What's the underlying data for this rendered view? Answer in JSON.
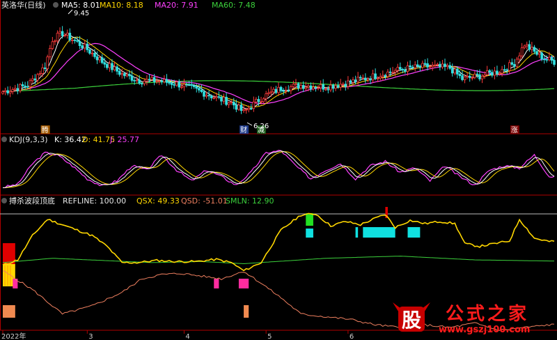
{
  "stock": {
    "name": "英洛华(日线)",
    "ma_labels": [
      "MA5: 8.01",
      "MA10: 8.18",
      "MA20: 7.91",
      "MA60: 7.48"
    ],
    "ma_colors": [
      "#ffffff",
      "#ffd700",
      "#ff40ff",
      "#3cd23c"
    ],
    "high_label": "9.45",
    "low_label": "6.26",
    "markers": [
      {
        "text": "腾",
        "day": 17
      },
      {
        "text": "财",
        "day": 97
      },
      {
        "text": "减",
        "day": 104
      },
      {
        "text": "涨",
        "day": 206
      }
    ]
  },
  "kdj": {
    "title": "KDJ(9,3,3)",
    "k": "K: 36.42",
    "d": "D: 41.75",
    "j": "J: 25.77",
    "colors": {
      "k": "#ffffff",
      "d": "#ffd700",
      "j": "#ff40ff"
    }
  },
  "indicator": {
    "title": "搏杀波段顶底",
    "refline": "REFLINE: 100.00",
    "qsx": "QSX: 49.33",
    "qsd": "QSD: -51.01",
    "smln": "SMLN: 12.90",
    "colors": {
      "refline": "#ffffff",
      "qsx": "#ffd700",
      "qsd": "#f08060",
      "smln": "#3cd23c"
    }
  },
  "xaxis": {
    "labels": [
      "2022年",
      "3",
      "4",
      "5",
      "6"
    ],
    "days": [
      0,
      34,
      73,
      106,
      139
    ]
  },
  "watermark": {
    "logo": "股",
    "title": "公式之家",
    "url": "www.gszj100.com"
  },
  "chart_data": [
    {
      "type": "candlestick",
      "title": "英洛华(日线)",
      "series": [
        {
          "name": "MA5",
          "last": 8.01
        },
        {
          "name": "MA10",
          "last": 8.18
        },
        {
          "name": "MA20",
          "last": 7.91
        },
        {
          "name": "MA60",
          "last": 7.48
        }
      ],
      "high_marker": 9.45,
      "low_marker": 6.26,
      "ylim": [
        6.0,
        9.7
      ],
      "close_path": [
        [
          0,
          7.2
        ],
        [
          10,
          7.4
        ],
        [
          17,
          8.0
        ],
        [
          20,
          8.85
        ],
        [
          24,
          9.05
        ],
        [
          28,
          8.85
        ],
        [
          33,
          8.6
        ],
        [
          40,
          8.15
        ],
        [
          48,
          7.75
        ],
        [
          55,
          7.55
        ],
        [
          62,
          7.55
        ],
        [
          70,
          7.45
        ],
        [
          78,
          7.25
        ],
        [
          86,
          7.0
        ],
        [
          92,
          6.85
        ],
        [
          97,
          6.55
        ],
        [
          100,
          6.75
        ],
        [
          105,
          7.05
        ],
        [
          112,
          7.3
        ],
        [
          120,
          7.4
        ],
        [
          130,
          7.35
        ],
        [
          140,
          7.5
        ],
        [
          150,
          7.7
        ],
        [
          160,
          7.9
        ],
        [
          170,
          8.0
        ],
        [
          180,
          7.95
        ],
        [
          185,
          7.6
        ],
        [
          192,
          7.7
        ],
        [
          200,
          7.85
        ],
        [
          206,
          8.1
        ],
        [
          210,
          8.7
        ],
        [
          214,
          8.45
        ],
        [
          218,
          8.25
        ],
        [
          222,
          8.15
        ]
      ],
      "bbox_days": 223
    },
    {
      "type": "line",
      "title": "KDJ(9,3,3)",
      "series": [
        {
          "name": "K",
          "last": 36.42
        },
        {
          "name": "D",
          "last": 41.75
        },
        {
          "name": "J",
          "last": 25.77
        }
      ],
      "ylim": [
        0,
        100
      ],
      "j_path": [
        [
          0,
          5
        ],
        [
          6,
          12
        ],
        [
          12,
          60
        ],
        [
          17,
          85
        ],
        [
          22,
          80
        ],
        [
          28,
          55
        ],
        [
          34,
          25
        ],
        [
          40,
          8
        ],
        [
          46,
          20
        ],
        [
          52,
          55
        ],
        [
          58,
          45
        ],
        [
          64,
          80
        ],
        [
          70,
          45
        ],
        [
          76,
          20
        ],
        [
          82,
          45
        ],
        [
          88,
          30
        ],
        [
          94,
          10
        ],
        [
          100,
          40
        ],
        [
          106,
          85
        ],
        [
          112,
          90
        ],
        [
          118,
          55
        ],
        [
          124,
          25
        ],
        [
          130,
          45
        ],
        [
          136,
          60
        ],
        [
          142,
          25
        ],
        [
          148,
          55
        ],
        [
          154,
          65
        ],
        [
          160,
          40
        ],
        [
          166,
          50
        ],
        [
          172,
          20
        ],
        [
          178,
          55
        ],
        [
          184,
          30
        ],
        [
          190,
          10
        ],
        [
          196,
          45
        ],
        [
          202,
          55
        ],
        [
          208,
          50
        ],
        [
          214,
          80
        ],
        [
          220,
          30
        ]
      ]
    },
    {
      "type": "line",
      "title": "搏杀波段顶底",
      "series": [
        {
          "name": "REFLINE",
          "last": 100.0
        },
        {
          "name": "QSX",
          "last": 49.33
        },
        {
          "name": "QSD",
          "last": -51.01
        },
        {
          "name": "SMLN",
          "last": 12.9
        }
      ],
      "ylim": [
        -110,
        110
      ],
      "qsx_path": [
        [
          0,
          5
        ],
        [
          6,
          15
        ],
        [
          12,
          60
        ],
        [
          18,
          90
        ],
        [
          24,
          80
        ],
        [
          30,
          70
        ],
        [
          36,
          60
        ],
        [
          42,
          40
        ],
        [
          48,
          10
        ],
        [
          54,
          10
        ],
        [
          62,
          14
        ],
        [
          70,
          12
        ],
        [
          78,
          12
        ],
        [
          86,
          16
        ],
        [
          92,
          10
        ],
        [
          97,
          -5
        ],
        [
          104,
          10
        ],
        [
          112,
          70
        ],
        [
          120,
          98
        ],
        [
          126,
          100
        ],
        [
          132,
          78
        ],
        [
          138,
          86
        ],
        [
          144,
          80
        ],
        [
          150,
          92
        ],
        [
          154,
          99
        ],
        [
          158,
          75
        ],
        [
          164,
          88
        ],
        [
          170,
          82
        ],
        [
          176,
          86
        ],
        [
          182,
          82
        ],
        [
          186,
          45
        ],
        [
          192,
          40
        ],
        [
          198,
          45
        ],
        [
          204,
          50
        ],
        [
          208,
          90
        ],
        [
          214,
          55
        ],
        [
          220,
          49
        ]
      ],
      "qsd_path": [
        [
          0,
          -5
        ],
        [
          12,
          -40
        ],
        [
          24,
          -85
        ],
        [
          36,
          -70
        ],
        [
          48,
          -45
        ],
        [
          56,
          -20
        ],
        [
          64,
          -12
        ],
        [
          72,
          -10
        ],
        [
          80,
          -15
        ],
        [
          88,
          -20
        ],
        [
          97,
          -6
        ],
        [
          104,
          -28
        ],
        [
          112,
          -55
        ],
        [
          120,
          -85
        ],
        [
          130,
          -90
        ],
        [
          140,
          -95
        ],
        [
          150,
          -105
        ],
        [
          160,
          -110
        ],
        [
          170,
          -105
        ],
        [
          180,
          -110
        ],
        [
          190,
          -102
        ],
        [
          200,
          -115
        ],
        [
          210,
          -110
        ],
        [
          220,
          -105
        ]
      ],
      "smln_path": [
        [
          0,
          10
        ],
        [
          20,
          18
        ],
        [
          40,
          14
        ],
        [
          60,
          10
        ],
        [
          80,
          12
        ],
        [
          97,
          8
        ],
        [
          110,
          12
        ],
        [
          130,
          18
        ],
        [
          160,
          22
        ],
        [
          190,
          15
        ],
        [
          220,
          13
        ]
      ]
    }
  ]
}
